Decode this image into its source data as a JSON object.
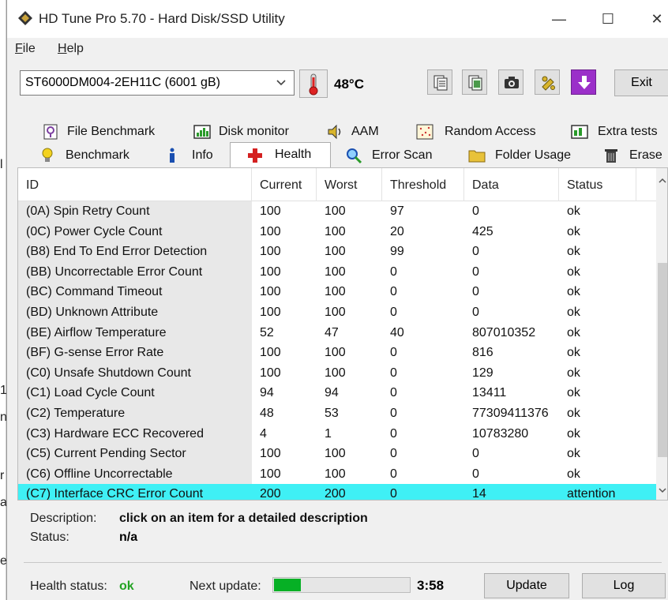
{
  "window": {
    "title": "HD Tune Pro 5.70 - Hard Disk/SSD Utility",
    "minimize": "—",
    "maximize": "☐",
    "close": "✕"
  },
  "menu": [
    {
      "u": "F",
      "rest": "ile"
    },
    {
      "u": "H",
      "rest": "elp"
    }
  ],
  "toolbar": {
    "drive": "ST6000DM004-2EH11C (6001 gB)",
    "temperature": "48°C",
    "exit_label": "Exit",
    "buttons": [
      "copy-text-icon",
      "copy-info-icon",
      "screenshot-icon",
      "options-icon",
      "save-download-icon"
    ]
  },
  "tabs_row1": [
    {
      "label": "File Benchmark",
      "icon": "file-benchmark-icon"
    },
    {
      "label": "Disk monitor",
      "icon": "disk-monitor-icon"
    },
    {
      "label": "AAM",
      "icon": "speaker-icon"
    },
    {
      "label": "Random Access",
      "icon": "random-access-icon"
    },
    {
      "label": "Extra tests",
      "icon": "extra-tests-icon"
    }
  ],
  "tabs_row2": [
    {
      "label": "Benchmark",
      "icon": "lightbulb-icon"
    },
    {
      "label": "Info",
      "icon": "info-icon"
    },
    {
      "label": "Health",
      "icon": "red-cross-icon",
      "active": true
    },
    {
      "label": "Error Scan",
      "icon": "magnifier-icon"
    },
    {
      "label": "Folder Usage",
      "icon": "folder-icon"
    },
    {
      "label": "Erase",
      "icon": "trash-icon"
    }
  ],
  "table": {
    "columns": [
      "ID",
      "Current",
      "Worst",
      "Threshold",
      "Data",
      "Status"
    ],
    "rows": [
      [
        "(0A) Spin Retry Count",
        "100",
        "100",
        "97",
        "0",
        "ok"
      ],
      [
        "(0C) Power Cycle Count",
        "100",
        "100",
        "20",
        "425",
        "ok"
      ],
      [
        "(B8) End To End Error Detection",
        "100",
        "100",
        "99",
        "0",
        "ok"
      ],
      [
        "(BB) Uncorrectable Error Count",
        "100",
        "100",
        "0",
        "0",
        "ok"
      ],
      [
        "(BC) Command Timeout",
        "100",
        "100",
        "0",
        "0",
        "ok"
      ],
      [
        "(BD) Unknown Attribute",
        "100",
        "100",
        "0",
        "0",
        "ok"
      ],
      [
        "(BE) Airflow Temperature",
        "52",
        "47",
        "40",
        "807010352",
        "ok"
      ],
      [
        "(BF) G-sense Error Rate",
        "100",
        "100",
        "0",
        "816",
        "ok"
      ],
      [
        "(C0) Unsafe Shutdown Count",
        "100",
        "100",
        "0",
        "129",
        "ok"
      ],
      [
        "(C1) Load Cycle Count",
        "94",
        "94",
        "0",
        "13411",
        "ok"
      ],
      [
        "(C2) Temperature",
        "48",
        "53",
        "0",
        "77309411376",
        "ok"
      ],
      [
        "(C3) Hardware ECC Recovered",
        "4",
        "1",
        "0",
        "10783280",
        "ok"
      ],
      [
        "(C5) Current Pending Sector",
        "100",
        "100",
        "0",
        "0",
        "ok"
      ],
      [
        "(C6) Offline Uncorrectable",
        "100",
        "100",
        "0",
        "0",
        "ok"
      ],
      [
        "(C7) Interface CRC Error Count",
        "200",
        "200",
        "0",
        "14",
        "attention"
      ]
    ],
    "selected_row": 14
  },
  "description": {
    "label": "Description:",
    "value": "click on an item for a detailed description",
    "status_label": "Status:",
    "status_value": "n/a"
  },
  "footer": {
    "health_label": "Health status:",
    "health_value": "ok",
    "next_update_label": "Next update:",
    "progress_fraction": 0.2,
    "time": "3:58",
    "update_label": "Update",
    "log_label": "Log"
  },
  "background_fragments": [
    "l",
    "1",
    "n",
    "r",
    "a",
    "e"
  ]
}
